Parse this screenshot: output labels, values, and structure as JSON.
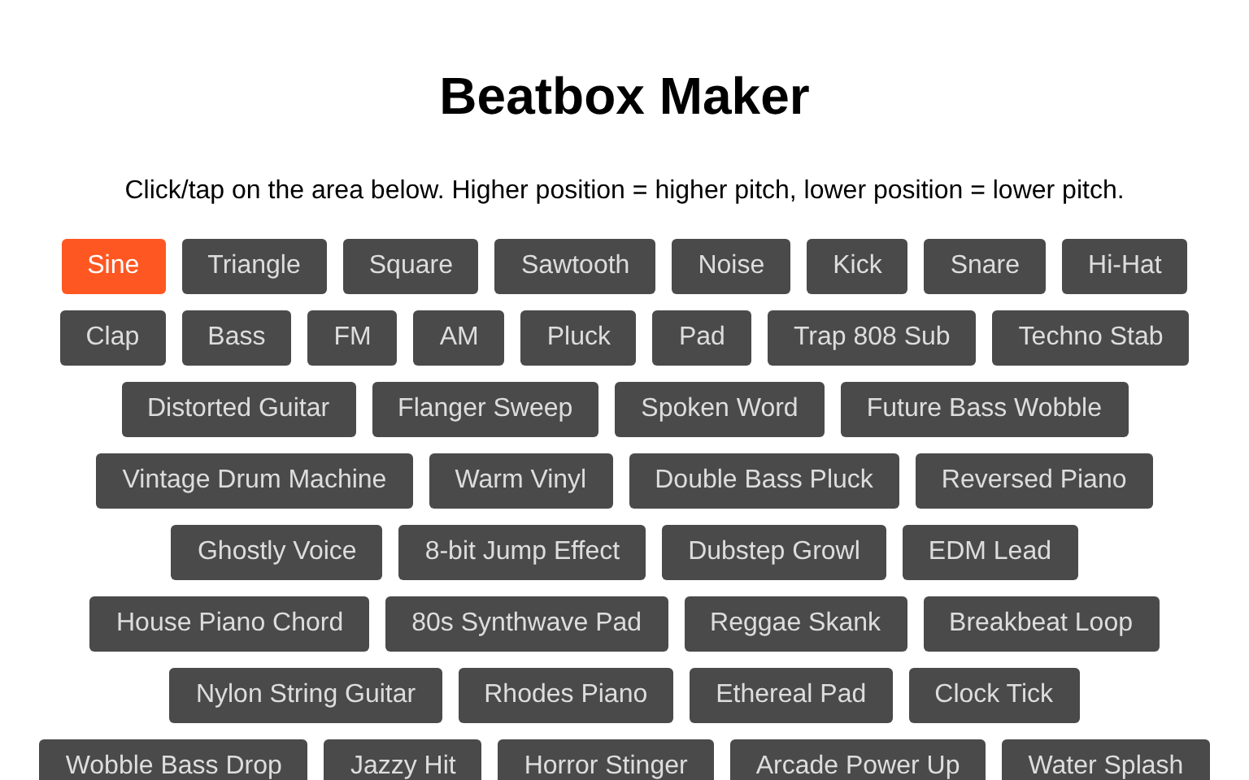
{
  "title": "Beatbox Maker",
  "instructions": "Click/tap on the area below. Higher position = higher pitch, lower position = lower pitch.",
  "sounds": [
    {
      "label": "Sine",
      "selected": true
    },
    {
      "label": "Triangle",
      "selected": false
    },
    {
      "label": "Square",
      "selected": false
    },
    {
      "label": "Sawtooth",
      "selected": false
    },
    {
      "label": "Noise",
      "selected": false
    },
    {
      "label": "Kick",
      "selected": false
    },
    {
      "label": "Snare",
      "selected": false
    },
    {
      "label": "Hi-Hat",
      "selected": false
    },
    {
      "label": "Clap",
      "selected": false
    },
    {
      "label": "Bass",
      "selected": false
    },
    {
      "label": "FM",
      "selected": false
    },
    {
      "label": "AM",
      "selected": false
    },
    {
      "label": "Pluck",
      "selected": false
    },
    {
      "label": "Pad",
      "selected": false
    },
    {
      "label": "Trap 808 Sub",
      "selected": false
    },
    {
      "label": "Techno Stab",
      "selected": false
    },
    {
      "label": "Distorted Guitar",
      "selected": false
    },
    {
      "label": "Flanger Sweep",
      "selected": false
    },
    {
      "label": "Spoken Word",
      "selected": false
    },
    {
      "label": "Future Bass Wobble",
      "selected": false
    },
    {
      "label": "Vintage Drum Machine",
      "selected": false
    },
    {
      "label": "Warm Vinyl",
      "selected": false
    },
    {
      "label": "Double Bass Pluck",
      "selected": false
    },
    {
      "label": "Reversed Piano",
      "selected": false
    },
    {
      "label": "Ghostly Voice",
      "selected": false
    },
    {
      "label": "8-bit Jump Effect",
      "selected": false
    },
    {
      "label": "Dubstep Growl",
      "selected": false
    },
    {
      "label": "EDM Lead",
      "selected": false
    },
    {
      "label": "House Piano Chord",
      "selected": false
    },
    {
      "label": "80s Synthwave Pad",
      "selected": false
    },
    {
      "label": "Reggae Skank",
      "selected": false
    },
    {
      "label": "Breakbeat Loop",
      "selected": false
    },
    {
      "label": "Nylon String Guitar",
      "selected": false
    },
    {
      "label": "Rhodes Piano",
      "selected": false
    },
    {
      "label": "Ethereal Pad",
      "selected": false
    },
    {
      "label": "Clock Tick",
      "selected": false
    },
    {
      "label": "Wobble Bass Drop",
      "selected": false
    },
    {
      "label": "Jazzy Hit",
      "selected": false
    },
    {
      "label": "Horror Stinger",
      "selected": false
    },
    {
      "label": "Arcade Power Up",
      "selected": false
    },
    {
      "label": "Water Splash",
      "selected": false
    }
  ]
}
